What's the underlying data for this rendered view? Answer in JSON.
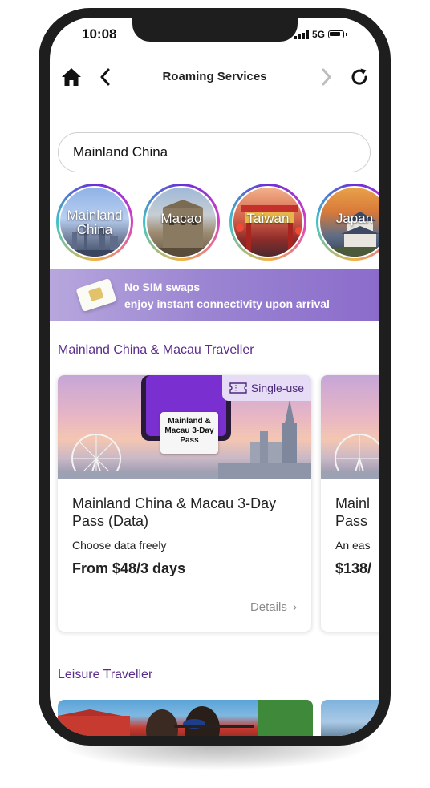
{
  "status_bar": {
    "time": "10:08",
    "network": "5G"
  },
  "nav": {
    "title": "Roaming Services"
  },
  "search": {
    "value": "Mainland China"
  },
  "destinations": [
    {
      "label": "Mainland China"
    },
    {
      "label": "Macao"
    },
    {
      "label": "Taiwan"
    },
    {
      "label": "Japan"
    }
  ],
  "banner": {
    "line1": "No SIM swaps",
    "line2": "enjoy instant connectivity upon arrival"
  },
  "section1": {
    "title": "Mainland China & Macau Traveller",
    "cards": [
      {
        "badge": "Single-use",
        "image_caption": "Mainland & Macau 3-Day Pass",
        "name": "Mainland China & Macau 3-Day Pass (Data)",
        "desc": "Choose data freely",
        "price": "From $48/3 days",
        "details": "Details"
      },
      {
        "name": "Mainl\nPass",
        "desc": "An eas",
        "price": "$138/"
      }
    ]
  },
  "section2": {
    "title": "Leisure Traveller"
  }
}
